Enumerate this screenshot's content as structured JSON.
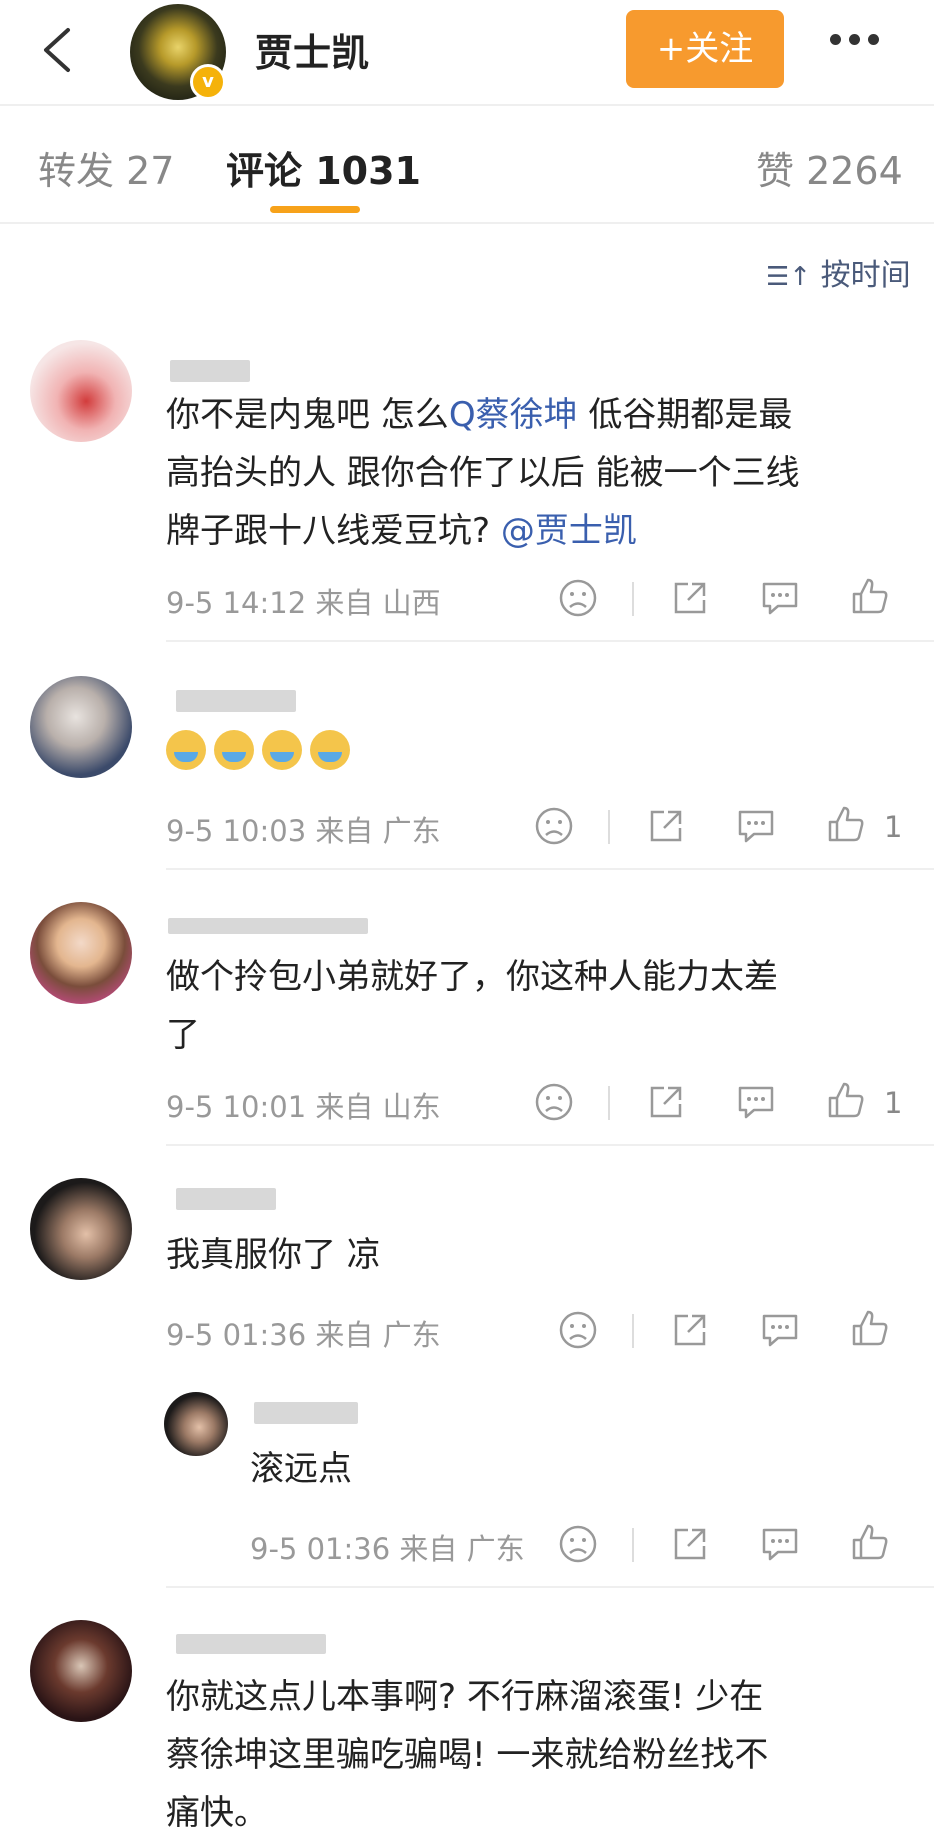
{
  "header": {
    "username": "贾士凯",
    "verified_badge": "v",
    "follow_label": "+关注"
  },
  "tabs": {
    "repost": "转发 27",
    "comment": "评论 1031",
    "like": "赞 2264"
  },
  "sort_label": "按时间",
  "comments": [
    {
      "text_before_mention": "你不是内鬼吧 怎么",
      "mention_topic": "蔡徐坤",
      "text_after_line1": " 低谷期都是最",
      "line2": "高抬头的人 跟你合作了以后 能被一个三线",
      "line3_prefix": "牌子跟十八线爱豆坑? ",
      "line3_mention": "@贾士凯",
      "meta": "9-5 14:12 来自 山西",
      "likes": ""
    },
    {
      "text": "",
      "meta": "9-5 10:03 来自 广东",
      "likes": "1"
    },
    {
      "line1": "做个拎包小弟就好了，你这种人能力太差",
      "line2": "了",
      "meta": "9-5 10:01 来自 山东",
      "likes": "1"
    },
    {
      "text": "我真服你了 凉",
      "meta": "9-5 01:36 来自 广东",
      "likes": ""
    },
    {
      "text": "滚远点",
      "meta": "9-5 01:36 来自 广东",
      "likes": ""
    },
    {
      "line1": "你就这点儿本事啊? 不行麻溜滚蛋! 少在",
      "line2": "蔡徐坤这里骗吃骗喝! 一来就给粉丝找不",
      "line3": "痛快。"
    }
  ],
  "colors": {
    "accent": "#f79a2e",
    "link": "#3a5fae",
    "tab_indicator": "#f7a21a"
  }
}
